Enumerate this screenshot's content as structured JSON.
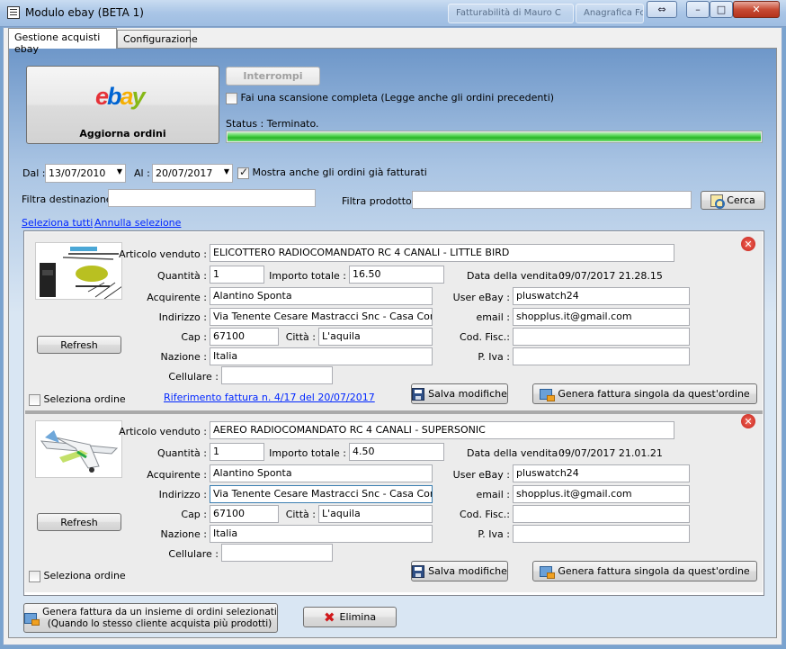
{
  "window": {
    "title": "Modulo ebay (BETA 1)",
    "background_tabs": [
      "Fatturabilità di Mauro C",
      "Anagrafica Fornitori"
    ],
    "restore_glyph": "⇔",
    "minimize_glyph": "–",
    "maximize_glyph": "□",
    "close_glyph": "✕"
  },
  "tabs": [
    {
      "label": "Gestione acquisti ebay",
      "active": true
    },
    {
      "label": "Configurazione",
      "active": false
    }
  ],
  "top": {
    "ebay_logo": [
      "e",
      "b",
      "a",
      "y"
    ],
    "ebay_logo_colors": [
      "#e53238",
      "#0064d2",
      "#f5af02",
      "#86b817"
    ],
    "update_button_label": "Aggiorna ordini",
    "stop_button_label": "Interrompi",
    "full_scan_label": "Fai una scansione completa (Legge anche gli ordini precedenti)",
    "full_scan_checked": false,
    "status_text": "Status : Terminato.",
    "progress": 1.0,
    "progress_color": "#27b527"
  },
  "filters": {
    "from_label": "Dal :",
    "from_value": "13/07/2010",
    "to_label": "Al :",
    "to_value": "20/07/2017",
    "show_invoiced_label": "Mostra anche gli ordini già fatturati",
    "show_invoiced_checked": true,
    "destination_label": "Filtra destinazione :",
    "destination_value": "",
    "product_label": "Filtra prodotto :",
    "product_value": "",
    "search_button_label": "Cerca",
    "select_all_label": "Seleziona tutti",
    "deselect_label": "Annulla selezione"
  },
  "labels": {
    "article": "Articolo venduto :",
    "quantity": "Quantità :",
    "total": "Importo totale :",
    "sale_date": "Data della vendita :",
    "buyer": "Acquirente :",
    "ebay_user": "User eBay :",
    "address": "Indirizzo :",
    "email": "email :",
    "zip": "Cap :",
    "city": "Città :",
    "tax_code": "Cod. Fisc.:",
    "country": "Nazione :",
    "vat": "P. Iva :",
    "mobile": "Cellulare :",
    "refresh": "Refresh",
    "select_order": "Seleziona ordine",
    "save_changes": "Salva modifiche",
    "single_invoice": "Genera fattura singola da quest'ordine"
  },
  "orders": [
    {
      "article": "ELICOTTERO RADIOCOMANDATO RC 4 CANALI - LITTLE BIRD",
      "quantity": "1",
      "total": "16.50",
      "sale_date": "09/07/2017 21.28.15",
      "buyer": "Alantino Sponta",
      "ebay_user": "pluswatch24",
      "address": "Via Tenente Cesare Mastracci Snc - Casa Con Murc",
      "email": "shopplus.it@gmail.com",
      "zip": "67100",
      "city": "L'aquila",
      "tax_code": "",
      "country": "Italia",
      "vat": "",
      "mobile": "",
      "invoice_ref": "Riferimento fattura n. 4/17 del 20/07/2017",
      "selected": false,
      "thumbnail": "helicopter"
    },
    {
      "article": "AEREO RADIOCOMANDATO RC 4 CANALI - SUPERSONIC",
      "quantity": "1",
      "total": "4.50",
      "sale_date": "09/07/2017 21.01.21",
      "buyer": "Alantino Sponta",
      "ebay_user": "pluswatch24",
      "address": "Via Tenente Cesare Mastracci Snc - Casa Con Murc",
      "email": "shopplus.it@gmail.com",
      "zip": "67100",
      "city": "L'aquila",
      "tax_code": "",
      "country": "Italia",
      "vat": "",
      "mobile": "",
      "invoice_ref": "",
      "selected": false,
      "thumbnail": "airplane"
    }
  ],
  "bottom": {
    "multi_invoice_line1": "Genera fattura da un insieme di ordini selezionati",
    "multi_invoice_line2": "(Quando lo stesso cliente acquista più prodotti)",
    "delete_label": "Elimina"
  }
}
